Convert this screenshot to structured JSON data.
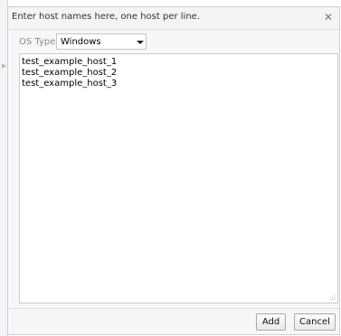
{
  "dialog": {
    "title": "Enter host names here, one host per line.",
    "close_icon": "close-icon"
  },
  "os_type": {
    "label": "OS Type",
    "selected": "Windows",
    "chevron_icon": "chevron-down-icon"
  },
  "hosts": {
    "lines": [
      "test_example_host_1",
      "test_example_host_2",
      "test_example_host_3"
    ]
  },
  "footer": {
    "add_label": "Add",
    "cancel_label": "Cancel"
  }
}
